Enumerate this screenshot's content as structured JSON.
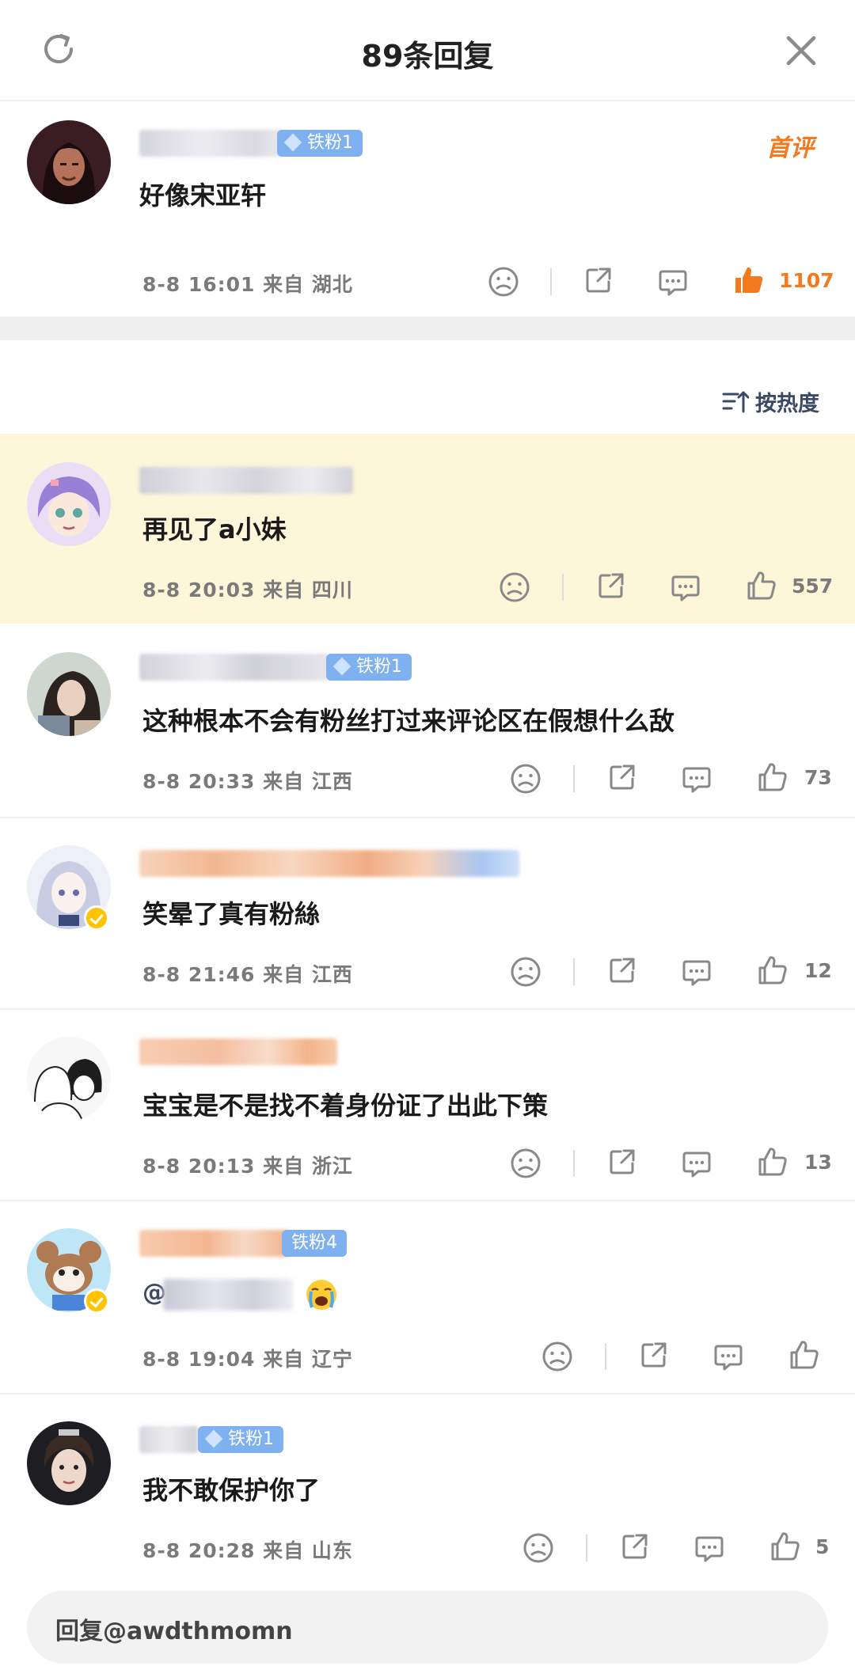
{
  "header": {
    "title": "89条回复"
  },
  "top_comment": {
    "fan_badge": "铁粉1",
    "first_tag": "首评",
    "text": "好像宋亚轩",
    "meta": "8-8  16:01  来自  湖北",
    "likes": "1107",
    "accent_color": "#f3781e"
  },
  "sort": {
    "label": "按热度"
  },
  "replies": [
    {
      "text": "再见了a小妹",
      "meta": "8-8  20:03  来自  四川",
      "likes": "557"
    },
    {
      "fan_badge": "铁粉1",
      "text": "这种根本不会有粉丝打过来评论区在假想什么敌",
      "meta": "8-8  20:33  来自  江西",
      "likes": "73"
    },
    {
      "text": "笑晕了真有粉絲",
      "meta": "8-8  21:46  来自  江西",
      "likes": "12"
    },
    {
      "text": "宝宝是不是找不着身份证了出此下策",
      "meta": "8-8  20:13  来自  浙江",
      "likes": "13"
    },
    {
      "fan_badge": "铁粉4",
      "mention_prefix": "@",
      "meta": "8-8  19:04  来自  辽宁",
      "likes": ""
    },
    {
      "fan_badge": "铁粉1",
      "text": "我不敢保护你了",
      "meta": "8-8  20:28  来自  山东",
      "likes": "5"
    }
  ],
  "reply_bar": {
    "placeholder": "回复@awdthmomn"
  },
  "colors": {
    "highlight_bg": "#fdf6d9",
    "badge_blue": "#7fb0f0",
    "meta_gray": "#7a7a7a"
  }
}
